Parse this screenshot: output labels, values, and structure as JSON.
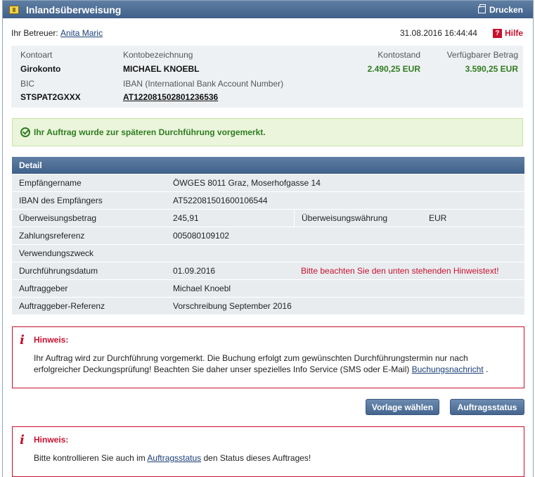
{
  "window": {
    "title": "Inlandsüberweisung",
    "print_label": "Drucken"
  },
  "meta": {
    "advisor_prefix": "Ihr Betreuer:",
    "advisor_name": "Anita Maric",
    "datetime": "31.08.2016 16:44:44",
    "help_label": "Hilfe"
  },
  "account": {
    "type_label": "Kontoart",
    "type_value": "Girokonto",
    "name_label": "Kontobezeichnung",
    "name_value": "MICHAEL KNOEBL",
    "balance_label": "Kontostand",
    "balance_value": "2.490,25 EUR",
    "available_label": "Verfügbarer Betrag",
    "available_value": "3.590,25 EUR",
    "bic_label": "BIC",
    "bic_value": "STSPAT2GXXX",
    "iban_label": "IBAN (International Bank Account Number)",
    "iban_value": "AT122081502801236536"
  },
  "success_message": "Ihr Auftrag wurde zur späteren Durchführung vorgemerkt.",
  "detail": {
    "header": "Detail",
    "recipient_label": "Empfängername",
    "recipient_value": "ÖWGES 8011 Graz, Moserhofgasse 14",
    "iban_label": "IBAN des Empfängers",
    "iban_value": "AT522081501600106544",
    "amount_label": "Überweisungsbetrag",
    "amount_value": "245,91",
    "currency_label": "Überweisungswährung",
    "currency_value": "EUR",
    "reference_label": "Zahlungsreferenz",
    "reference_value": "005080109102",
    "purpose_label": "Verwendungszweck",
    "purpose_value": "",
    "date_label": "Durchführungsdatum",
    "date_value": "01.09.2016",
    "date_warning": "Bitte beachten Sie den unten stehenden Hinweistext!",
    "orderer_label": "Auftraggeber",
    "orderer_value": "Michael Knoebl",
    "orderer_ref_label": "Auftraggeber-Referenz",
    "orderer_ref_value": "Vorschreibung September 2016"
  },
  "hint1": {
    "title": "Hinweis:",
    "line1": "Ihr Auftrag wird zur Durchführung vorgemerkt. Die Buchung erfolgt zum gewünschten Durchführungstermin nur nach",
    "line2_prefix": "erfolgreicher Deckungsprüfung! Beachten Sie daher unser spezielles Info Service (SMS oder E-Mail)",
    "line2_link": "Buchungsnachricht",
    "line2_suffix": "."
  },
  "buttons": {
    "template": "Vorlage wählen",
    "status": "Auftragsstatus"
  },
  "hint2": {
    "title": "Hinweis:",
    "prefix": "Bitte kontrollieren Sie auch im",
    "link": "Auftragsstatus",
    "suffix": "den Status dieses Auftrages!"
  },
  "colors": {
    "accent": "#4a6a92",
    "success": "#2f7d1f",
    "warning": "#c8102e"
  },
  "icons": {
    "title": "transfer-icon",
    "print": "printer-icon",
    "help": "help-icon",
    "success": "check-circle-icon",
    "hint": "info-icon"
  }
}
